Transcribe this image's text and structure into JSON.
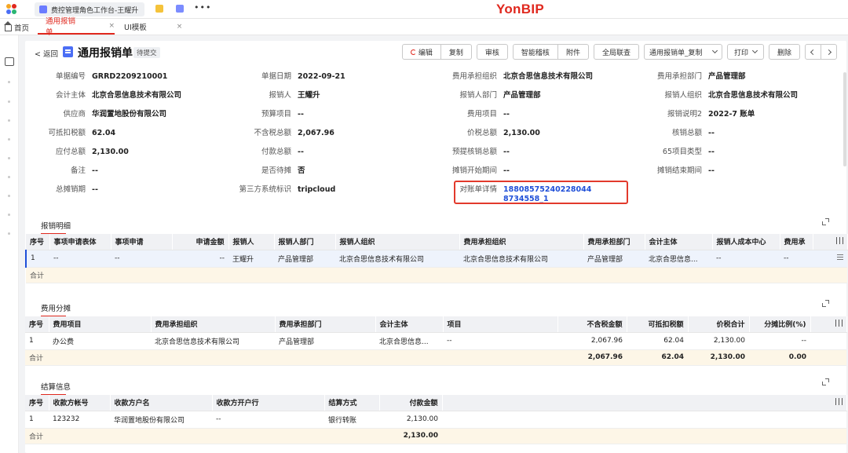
{
  "brand": "YonBIP",
  "top_tab": {
    "title": "费控管理角色工作台-王耀升"
  },
  "nav": {
    "home": "首页",
    "tabs": [
      {
        "label": "通用报销单",
        "active": true
      },
      {
        "label": "UI模板",
        "active": false
      }
    ],
    "close": "×"
  },
  "header": {
    "back": "< 返回",
    "title": "通用报销单",
    "status": "待提交",
    "buttons": {
      "edit": "编辑",
      "copy": "复制",
      "review": "审核",
      "smart_audit": "智能稽核",
      "attachment": "附件",
      "global_query": "全局联查",
      "template_select": "通用报销单_复制",
      "print": "打印",
      "delete": "删除"
    }
  },
  "form": {
    "fields": [
      {
        "label": "单据编号",
        "value": "GRRD2209210001"
      },
      {
        "label": "单据日期",
        "value": "2022-09-21"
      },
      {
        "label": "费用承担组织",
        "value": "北京合思信息技术有限公司"
      },
      {
        "label": "费用承担部门",
        "value": "产品管理部"
      },
      {
        "label": "会计主体",
        "value": "北京合思信息技术有限公司"
      },
      {
        "label": "报销人",
        "value": "王耀升"
      },
      {
        "label": "报销人部门",
        "value": "产品管理部"
      },
      {
        "label": "报销人组织",
        "value": "北京合思信息技术有限公司"
      },
      {
        "label": "供应商",
        "value": "华润置地股份有限公司"
      },
      {
        "label": "预算项目",
        "value": "--"
      },
      {
        "label": "费用项目",
        "value": "--"
      },
      {
        "label": "报销说明2",
        "value": "2022-7 账单"
      },
      {
        "label": "可抵扣税额",
        "value": "62.04"
      },
      {
        "label": "不含税总额",
        "value": "2,067.96"
      },
      {
        "label": "价税总额",
        "value": "2,130.00"
      },
      {
        "label": "核销总额",
        "value": "--"
      },
      {
        "label": "应付总额",
        "value": "2,130.00"
      },
      {
        "label": "付款总额",
        "value": "--"
      },
      {
        "label": "预提核销总额",
        "value": "--"
      },
      {
        "label": "65项目类型",
        "value": "--"
      },
      {
        "label": "备注",
        "value": "--"
      },
      {
        "label": "是否待摊",
        "value": "否"
      },
      {
        "label": "摊销开始期间",
        "value": "--"
      },
      {
        "label": "摊销结束期间",
        "value": "--"
      },
      {
        "label": "总摊销期",
        "value": "--"
      },
      {
        "label": "第三方系统标识",
        "value": "tripcloud"
      },
      {
        "label": "对账单详情",
        "value": "188085752402280448734558_1"
      }
    ]
  },
  "detail": {
    "title": "报销明细",
    "columns": [
      "序号",
      "事项申请表体",
      "事项申请",
      "申请金额",
      "报销人",
      "报销人部门",
      "报销人组织",
      "费用承担组织",
      "费用承担部门",
      "会计主体",
      "报销人成本中心",
      "费用承"
    ],
    "rows": [
      [
        "1",
        "--",
        "--",
        "--",
        "王耀升",
        "产品管理部",
        "北京合思信息技术有限公司",
        "北京合思信息技术有限公司",
        "产品管理部",
        "北京合思信息...",
        "--",
        "--"
      ]
    ],
    "total_label": "合计"
  },
  "allocation": {
    "title": "费用分摊",
    "columns": [
      "序号",
      "费用项目",
      "费用承担组织",
      "费用承担部门",
      "会计主体",
      "项目",
      "不含税金额",
      "可抵扣税额",
      "价税合计",
      "分摊比例(%)"
    ],
    "rows": [
      [
        "1",
        "办公费",
        "北京合思信息技术有限公司",
        "产品管理部",
        "北京合思信息...",
        "--",
        "2,067.96",
        "62.04",
        "2,130.00",
        "--"
      ]
    ],
    "total": [
      "合计",
      "",
      "",
      "",
      "",
      "",
      "2,067.96",
      "62.04",
      "2,130.00",
      "0.00"
    ]
  },
  "settlement": {
    "title": "结算信息",
    "columns": [
      "序号",
      "收款方帐号",
      "收款方户名",
      "收款方开户行",
      "结算方式",
      "付款金额"
    ],
    "rows": [
      [
        "1",
        "123232",
        "华润置地股份有限公司",
        "--",
        "银行转账",
        "2,130.00"
      ]
    ],
    "total": [
      "合计",
      "",
      "",
      "",
      "",
      "2,130.00"
    ]
  },
  "colors": {
    "brand": "#e0281e",
    "link": "#1f4fd8",
    "highlight": "#e23a2c"
  }
}
